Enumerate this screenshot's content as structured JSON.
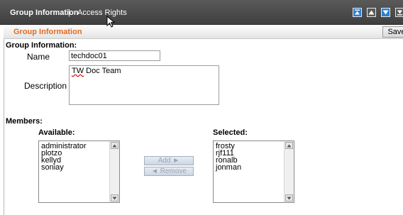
{
  "tabs": {
    "group": "Group Information",
    "separator": "|",
    "access": "Access Rights"
  },
  "section": {
    "title": "Group Information",
    "save_label": "Save"
  },
  "form": {
    "heading": "Group Information:",
    "name_label": "Name",
    "name_value": "techdoc01",
    "description_label": "Description",
    "description_value_misspelled": "TW",
    "description_value_rest": " Doc Team"
  },
  "members": {
    "heading": "Members:",
    "available_label": "Available:",
    "selected_label": "Selected:",
    "available": [
      "administrator",
      "plotzo",
      "kellyd",
      "soniay"
    ],
    "selected": [
      "frosty",
      "rjf111",
      "ronalb",
      "jonman"
    ],
    "add_label": "Add ►",
    "remove_label": "◄ Remove"
  },
  "colors": {
    "accent_orange": "#e06a24",
    "topbar": "#4a4a4a",
    "window_button_blue": "#2d7fd1",
    "disabled_button_text": "#9aa4b3"
  },
  "icons": {
    "window_buttons": [
      "move-top-icon",
      "move-up-icon",
      "move-down-icon",
      "move-bottom-icon"
    ],
    "cursor": "mouse-pointer-icon"
  }
}
